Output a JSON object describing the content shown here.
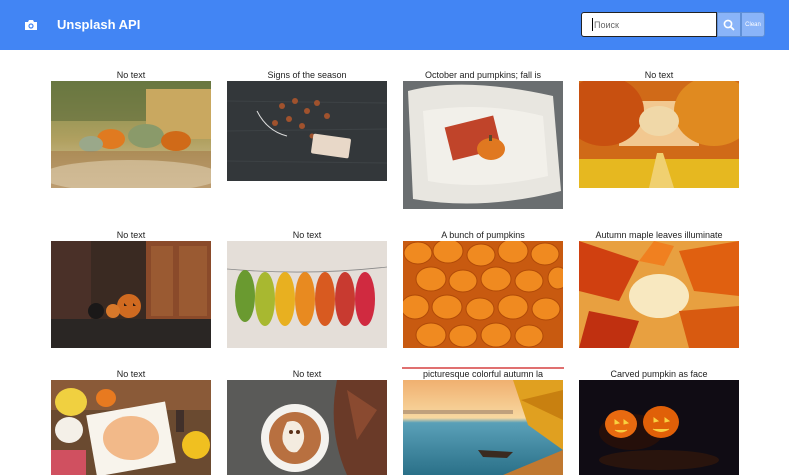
{
  "header": {
    "brand": "Unsplash API",
    "search_placeholder": "Поиск",
    "clean_label": "Clean",
    "icons": {
      "brand": "camera-icon",
      "search": "search-icon"
    }
  },
  "theme": {
    "navbar": "#4285f4",
    "button": "#8ab4f8"
  },
  "gallery": {
    "items": [
      {
        "caption": "No text",
        "image": "autumn pumpkins and hay bales"
      },
      {
        "caption": "Signs of the season",
        "image": "acorns and tag on dark wood"
      },
      {
        "caption": "October and pumpkins; fall is",
        "image": "knitted blanket with pumpkin and book"
      },
      {
        "caption": "No text",
        "image": "orange trees over a yellow path"
      },
      {
        "caption": "No text",
        "image": "jack-o-lanterns by a wooden door"
      },
      {
        "caption": "No text",
        "image": "colorful leaves on a string"
      },
      {
        "caption": "A bunch of pumpkins",
        "image": "pile of orange pumpkins"
      },
      {
        "caption": "Autumn maple leaves illuminate",
        "image": "backlit maple leaves"
      },
      {
        "caption": "No text",
        "image": "hello october still life"
      },
      {
        "caption": "No text",
        "image": "latte art ghost in a cup"
      },
      {
        "caption": "picturesque colorful autumn la",
        "image": "lake with boat at sunset"
      },
      {
        "caption": "Carved pumpkin as face",
        "image": "glowing carved pumpkins at night"
      }
    ]
  }
}
